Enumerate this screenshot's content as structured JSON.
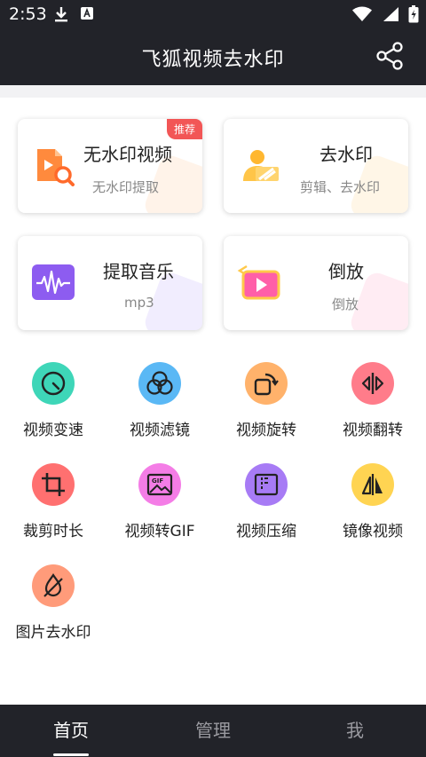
{
  "status_bar": {
    "time": "2:53"
  },
  "header": {
    "title": "飞狐视频去水印"
  },
  "cards": [
    {
      "title": "无水印视频",
      "subtitle": "无水印提取",
      "badge": "推荐"
    },
    {
      "title": "去水印",
      "subtitle": "剪辑、去水印"
    },
    {
      "title": "提取音乐",
      "subtitle": "mp3"
    },
    {
      "title": "倒放",
      "subtitle": "倒放"
    }
  ],
  "tools": [
    {
      "label": "视频变速",
      "color": "#3ed6b8"
    },
    {
      "label": "视频滤镜",
      "color": "#5ab8f5"
    },
    {
      "label": "视频旋转",
      "color": "#ffb26b"
    },
    {
      "label": "视频翻转",
      "color": "#ff7c8a"
    },
    {
      "label": "裁剪时长",
      "color": "#ff7070"
    },
    {
      "label": "视频转GIF",
      "color": "#f47de6"
    },
    {
      "label": "视频压缩",
      "color": "#a77bf5"
    },
    {
      "label": "镜像视频",
      "color": "#ffd452"
    },
    {
      "label": "图片去水印",
      "color": "#ff9b7a"
    }
  ],
  "bottom_nav": {
    "tabs": [
      {
        "label": "首页"
      },
      {
        "label": "管理"
      },
      {
        "label": "我"
      }
    ]
  },
  "colors": {
    "top_bar": "#222329",
    "accent_red": "#f25656"
  }
}
